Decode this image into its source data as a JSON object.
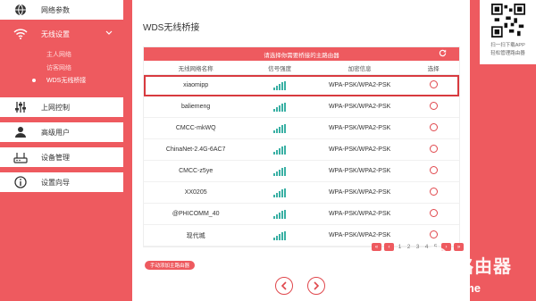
{
  "sidebar": {
    "items": [
      {
        "label": "网络参数",
        "icon": "globe-icon"
      },
      {
        "label": "无线设置",
        "icon": "wifi-icon"
      },
      {
        "label": "上网控制",
        "icon": "sliders-icon"
      },
      {
        "label": "高级用户",
        "icon": "user-icon"
      },
      {
        "label": "设备管理",
        "icon": "router-icon"
      },
      {
        "label": "设置向导",
        "icon": "info-icon"
      }
    ],
    "submenu": [
      "主人网络",
      "访客网络",
      "WDS无线桥接"
    ]
  },
  "main": {
    "title": "WDS无线桥接",
    "table_hint": "请选择你需要桥接的主路由器",
    "columns": [
      "无线网络名称",
      "信号强度",
      "加密信息",
      "选择"
    ],
    "rows": [
      {
        "ssid": "xiaomipp",
        "signal": 4,
        "security": "WPA-PSK/WPA2-PSK"
      },
      {
        "ssid": "baliemeng",
        "signal": 4,
        "security": "WPA-PSK/WPA2-PSK"
      },
      {
        "ssid": "CMCC-mkWQ",
        "signal": 4,
        "security": "WPA-PSK/WPA2-PSK"
      },
      {
        "ssid": "ChinaNet-2.4G-6AC7",
        "signal": 4,
        "security": "WPA-PSK/WPA2-PSK"
      },
      {
        "ssid": "CMCC-z5ye",
        "signal": 4,
        "security": "WPA-PSK/WPA2-PSK"
      },
      {
        "ssid": "XX0205",
        "signal": 4,
        "security": "WPA-PSK/WPA2-PSK"
      },
      {
        "ssid": "@PHICOMM_40",
        "signal": 4,
        "security": "WPA-PSK/WPA2-PSK"
      },
      {
        "ssid": "现代城",
        "signal": 4,
        "security": "WPA-PSK/WPA2-PSK"
      }
    ],
    "pager": {
      "pages": [
        "1",
        "2",
        "3",
        "4",
        "5"
      ]
    },
    "add_manual": "手动添加主路由器"
  },
  "qr": {
    "line1": "扫一扫下载APP",
    "line2": "轻松管理路由器"
  },
  "watermark": {
    "brand": "路由器",
    "author": "头条 @迷你科技秀time"
  },
  "colors": {
    "accent": "#ee5a5f",
    "signal": "#3ab0a4"
  }
}
